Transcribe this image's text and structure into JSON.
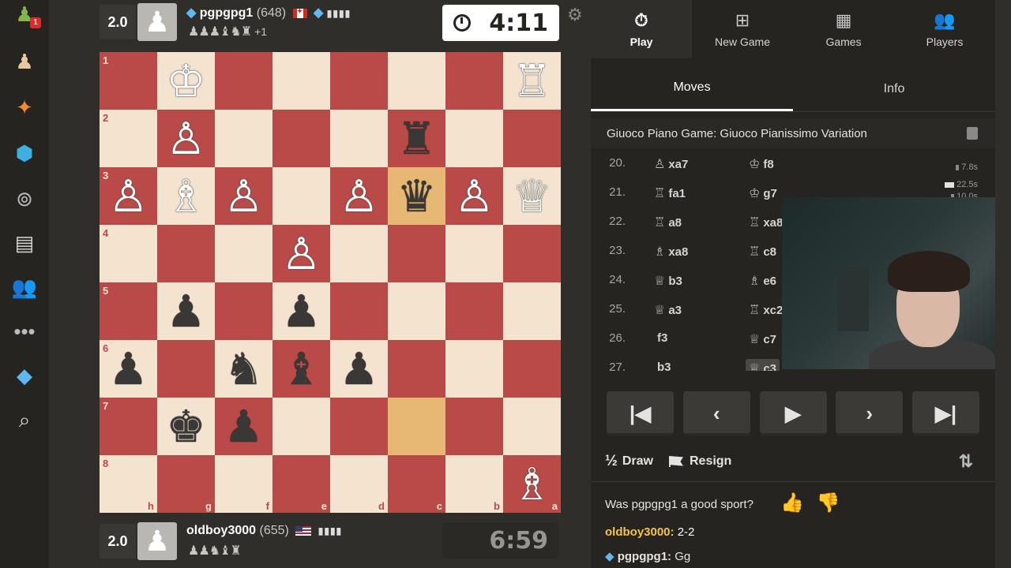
{
  "top_player": {
    "score": "2.0",
    "name": "pgpgpg1",
    "rating": "(648)",
    "captured": "♟♟♟♝♞♜",
    "captured_extra": "+1",
    "clock": "4:11"
  },
  "bottom_player": {
    "score": "2.0",
    "name": "oldboy3000",
    "rating": "(655)",
    "captured": "♟♟♞♝♜",
    "clock": "6:59"
  },
  "board": {
    "files": [
      "h",
      "g",
      "f",
      "e",
      "d",
      "c",
      "b",
      "a"
    ],
    "ranks": [
      "1",
      "2",
      "3",
      "4",
      "5",
      "6",
      "7",
      "8"
    ],
    "highlight_squares": [
      "c3",
      "c7"
    ],
    "pieces": {
      "g1": {
        "glyph": "♔",
        "color": "white"
      },
      "a1": {
        "glyph": "♖",
        "color": "white"
      },
      "g2": {
        "glyph": "♙",
        "color": "white"
      },
      "c2": {
        "glyph": "♜",
        "color": "black"
      },
      "h3": {
        "glyph": "♙",
        "color": "white"
      },
      "g3": {
        "glyph": "♗",
        "color": "white"
      },
      "f3": {
        "glyph": "♙",
        "color": "white"
      },
      "d3": {
        "glyph": "♙",
        "color": "white"
      },
      "c3": {
        "glyph": "♛",
        "color": "black"
      },
      "b3": {
        "glyph": "♙",
        "color": "white"
      },
      "a3": {
        "glyph": "♕",
        "color": "white"
      },
      "e4": {
        "glyph": "♙",
        "color": "white"
      },
      "g5": {
        "glyph": "♟",
        "color": "black"
      },
      "e5": {
        "glyph": "♟",
        "color": "black"
      },
      "h6": {
        "glyph": "♟",
        "color": "black"
      },
      "f6": {
        "glyph": "♞",
        "color": "black"
      },
      "e6": {
        "glyph": "♝",
        "color": "black"
      },
      "d6": {
        "glyph": "♟",
        "color": "black"
      },
      "g7": {
        "glyph": "♚",
        "color": "black"
      },
      "f7": {
        "glyph": "♟",
        "color": "black"
      },
      "a8": {
        "glyph": "♗",
        "color": "white"
      }
    }
  },
  "nav": [
    {
      "label": "Play",
      "icon": "stopwatch-icon",
      "glyph": "⏱"
    },
    {
      "label": "New Game",
      "icon": "plus-icon",
      "glyph": "⊞"
    },
    {
      "label": "Games",
      "icon": "board-icon",
      "glyph": "▦"
    },
    {
      "label": "Players",
      "icon": "players-icon",
      "glyph": "👥"
    }
  ],
  "tabs": {
    "moves": "Moves",
    "info": "Info"
  },
  "opening": "Giuoco Piano Game: Giuoco Pianissimo Variation",
  "moves": [
    {
      "num": "20.",
      "w_glyph": "♙",
      "w": "xa7",
      "b_glyph": "♔",
      "b": "f8",
      "t1": "",
      "t2": "7.8s"
    },
    {
      "num": "21.",
      "w_glyph": "♖",
      "w": "fa1",
      "b_glyph": "♔",
      "b": "g7",
      "t1": "22.5s",
      "t2": "10.0s"
    },
    {
      "num": "22.",
      "w_glyph": "♖",
      "w": "a8",
      "b_glyph": "♖",
      "b": "xa8",
      "t1": "",
      "t2": ""
    },
    {
      "num": "23.",
      "w_glyph": "♗",
      "w": "xa8",
      "b_glyph": "♖",
      "b": "c8",
      "t1": "",
      "t2": ""
    },
    {
      "num": "24.",
      "w_glyph": "♕",
      "w": "b3",
      "b_glyph": "♗",
      "b": "e6",
      "t1": "",
      "t2": ""
    },
    {
      "num": "25.",
      "w_glyph": "♕",
      "w": "a3",
      "b_glyph": "♖",
      "b": "xc2",
      "t1": "",
      "t2": ""
    },
    {
      "num": "26.",
      "w_glyph": "",
      "w": "f3",
      "b_glyph": "♕",
      "b": "c7",
      "t1": "",
      "t2": ""
    },
    {
      "num": "27.",
      "w_glyph": "",
      "w": "b3",
      "b_glyph": "♕",
      "b": "c3",
      "t1": "",
      "t2": ""
    }
  ],
  "controls": {
    "first": "|◀",
    "prev": "‹",
    "play": "▶",
    "next": "›",
    "last": "▶|"
  },
  "actions": {
    "half": "½",
    "draw": "Draw",
    "resign": "Resign"
  },
  "chat": {
    "question": "Was pgpgpg1 a good sport?",
    "messages": [
      {
        "user": "oldboy3000:",
        "text": " 2-2"
      },
      {
        "user": "pgpgpg1:",
        "text": " Gg"
      }
    ]
  },
  "colors": {
    "light_square": "#f3e3cf",
    "dark_square": "#b94a48",
    "highlight": "#e6b873",
    "background": "#302e2b"
  }
}
